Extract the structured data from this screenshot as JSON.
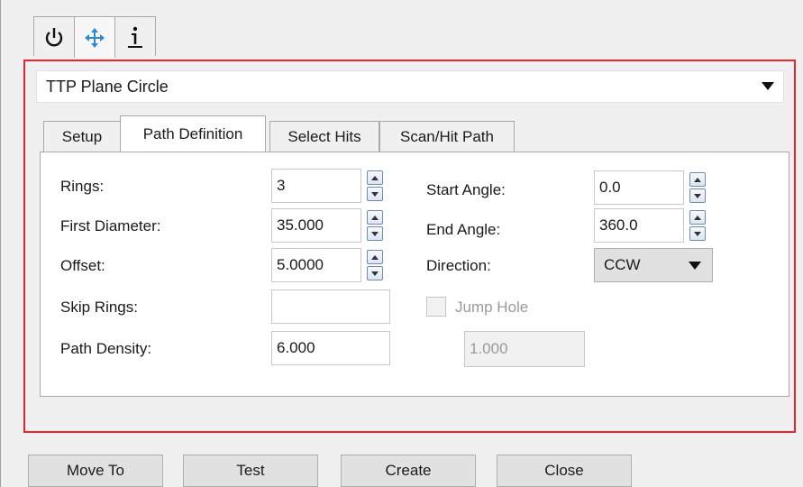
{
  "toolbar_tabs": [
    {
      "icon": "power-icon",
      "active": false
    },
    {
      "icon": "move-arrows-icon",
      "active": true
    },
    {
      "icon": "info-icon",
      "active": false
    }
  ],
  "header": {
    "selected_type": "TTP Plane Circle"
  },
  "tabs": [
    {
      "label": "Setup",
      "active": false
    },
    {
      "label": "Path Definition",
      "active": true
    },
    {
      "label": "Select Hits",
      "active": false
    },
    {
      "label": "Scan/Hit Path",
      "active": false
    }
  ],
  "form": {
    "rings": {
      "label": "Rings:",
      "value": "3"
    },
    "first_diameter": {
      "label": "First Diameter:",
      "value": "35.000"
    },
    "offset": {
      "label": "Offset:",
      "value": "5.0000"
    },
    "skip_rings": {
      "label": "Skip Rings:",
      "value": ""
    },
    "path_density": {
      "label": "Path Density:",
      "value": "6.000"
    },
    "start_angle": {
      "label": "Start Angle:",
      "value": "0.0"
    },
    "end_angle": {
      "label": "End Angle:",
      "value": "360.0"
    },
    "direction": {
      "label": "Direction:",
      "value": "CCW"
    },
    "jump_hole": {
      "label": "Jump Hole",
      "checked": false,
      "value": "1.000"
    }
  },
  "buttons": {
    "move_to": "Move To",
    "test": "Test",
    "create": "Create",
    "close": "Close"
  },
  "colors": {
    "highlight_frame": "#e8242c",
    "spin_border": "#6d8ab2"
  }
}
